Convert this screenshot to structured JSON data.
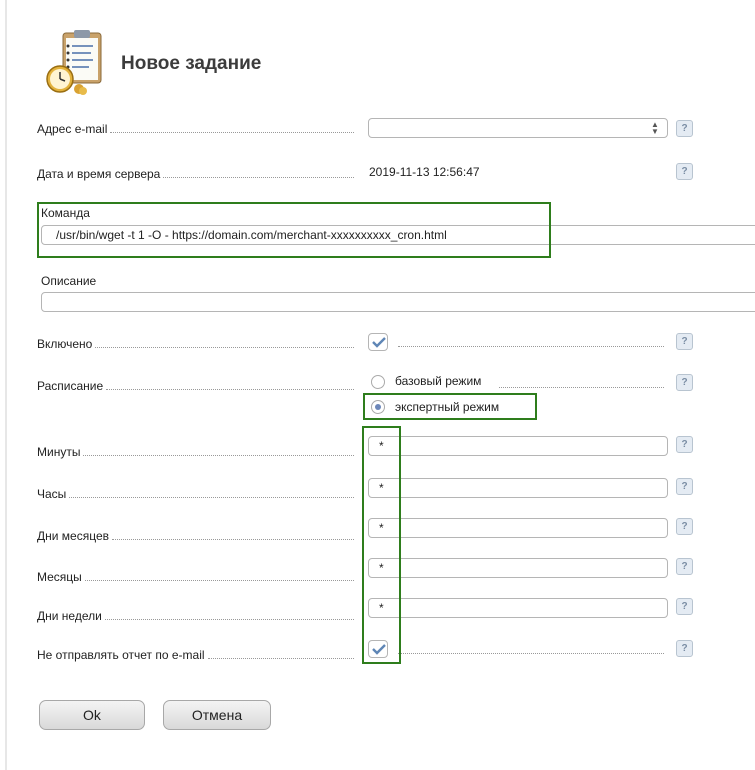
{
  "title": "Новое задание",
  "help_glyph": "?",
  "fields": {
    "email": {
      "label": "Адрес e-mail",
      "value": ""
    },
    "server_time": {
      "label": "Дата и время сервера",
      "value": "2019-11-13 12:56:47"
    },
    "command": {
      "label": "Команда",
      "value": "/usr/bin/wget -t 1 -O - https://domain.com/merchant-xxxxxxxxxx_cron.html"
    },
    "description": {
      "label": "Описание",
      "value": ""
    },
    "enabled": {
      "label": "Включено",
      "checked": true
    },
    "schedule": {
      "label": "Расписание",
      "options": [
        {
          "label": "базовый режим",
          "selected": false
        },
        {
          "label": "экспертный режим",
          "selected": true
        }
      ]
    },
    "minutes": {
      "label": "Минуты",
      "value": "*"
    },
    "hours": {
      "label": "Часы",
      "value": "*"
    },
    "days_of_month": {
      "label": "Дни месяцев",
      "value": "*"
    },
    "months": {
      "label": "Месяцы",
      "value": "*"
    },
    "days_of_week": {
      "label": "Дни недели",
      "value": "*"
    },
    "no_email_report": {
      "label": "Не отправлять отчет по e-mail",
      "checked": true
    }
  },
  "buttons": {
    "ok": "Ok",
    "cancel": "Отмена"
  },
  "colors": {
    "highlight": "#2e7d1c",
    "check": "#5f86b6",
    "radio_selected": "#6d87b9"
  },
  "icons": {
    "header": "scheduler-clipboard-clock-icon",
    "help": "help-question-icon",
    "check": "checkmark-icon"
  }
}
